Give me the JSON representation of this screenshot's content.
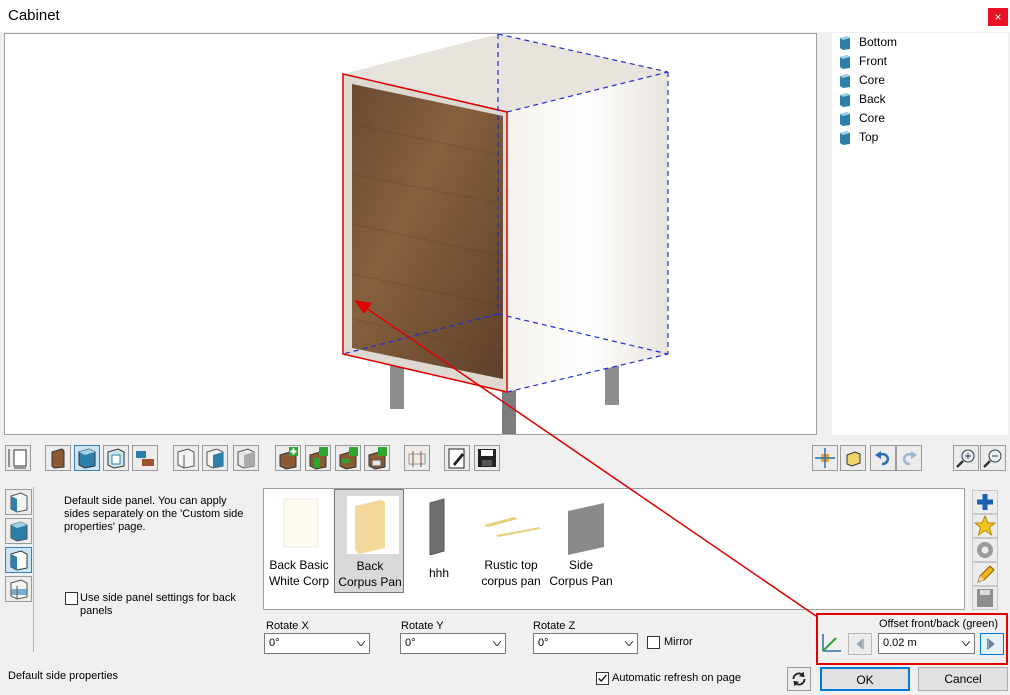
{
  "window": {
    "title": "Cabinet",
    "close_glyph": "×"
  },
  "tree": {
    "items": [
      "Bottom",
      "Front",
      "Core",
      "Back",
      "Core",
      "Top"
    ],
    "icon": "panel-icon"
  },
  "toolbar": {
    "icons": [
      "dimensions-icon",
      "door-panel-icon",
      "side-panel-icon",
      "frame-icon",
      "drawer-icon",
      "cabinet-outline-icon",
      "cabinet-teal-icon",
      "cabinet-grey-icon",
      "add-panel-icon",
      "add-shelf-icon",
      "add-front-icon",
      "add-drawer-icon",
      "hardware-icon",
      "edit-icon",
      "save-icon",
      "move-icon",
      "cube-icon",
      "undo-icon",
      "redo-icon",
      "zoom-in-icon",
      "zoom-out-icon"
    ]
  },
  "side_tabs": {
    "icons": [
      "panel-left-icon",
      "panel-front-icon",
      "panel-side-icon",
      "panel-wire-icon"
    ]
  },
  "description": "Default side panel. You can apply sides separately on the 'Custom side properties' page.",
  "use_side_panel": {
    "label": "Use side panel settings for back panels",
    "checked": false
  },
  "gallery": {
    "items": [
      {
        "label1": "Back Basic",
        "label2": "White Corp",
        "color": "#fcfaf1",
        "selected": false
      },
      {
        "label1": "Back",
        "label2": "Corpus Pan",
        "color": "#f4d79a",
        "selected": true
      },
      {
        "label1": "hhh",
        "label2": "",
        "color": "#707070",
        "selected": false
      },
      {
        "label1": "Rustic top",
        "label2": "corpus pan",
        "color": "#e8cf7a",
        "selected": false
      },
      {
        "label1": "Side",
        "label2": "Corpus Pan",
        "color": "#8a8a8a",
        "selected": false
      }
    ]
  },
  "right_buttons": {
    "icons": [
      "add-icon",
      "star-icon",
      "gear-icon",
      "pencil-icon",
      "disk-icon"
    ]
  },
  "rotate": {
    "x": {
      "label": "Rotate X",
      "value": "0°"
    },
    "y": {
      "label": "Rotate Y",
      "value": "0°"
    },
    "z": {
      "label": "Rotate Z",
      "value": "0°"
    }
  },
  "mirror": {
    "label": "Mirror",
    "checked": false
  },
  "offset": {
    "label": "Offset front/back (green)",
    "value": "0.02 m"
  },
  "status_text": "Default side properties",
  "auto_refresh": {
    "label": "Automatic refresh on page",
    "checked": true
  },
  "buttons": {
    "ok": "OK",
    "cancel": "Cancel"
  },
  "colors": {
    "accent": "#0078d7",
    "highlight": "#e00000",
    "close": "#e81123"
  }
}
